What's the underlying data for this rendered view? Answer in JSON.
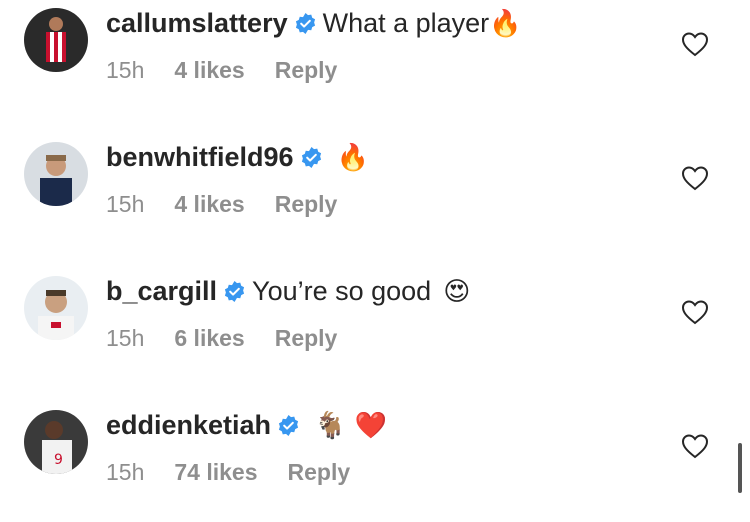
{
  "comments": [
    {
      "username": "callumslattery",
      "text": "What a player",
      "emoji": "🔥",
      "time": "15h",
      "likes": "4 likes",
      "reply": "Reply"
    },
    {
      "username": "benwhitfield96",
      "text": "",
      "emoji": "🔥",
      "time": "15h",
      "likes": "4 likes",
      "reply": "Reply"
    },
    {
      "username": "b_cargill",
      "text": "You’re so good",
      "emoji": "😍",
      "time": "15h",
      "likes": "6 likes",
      "reply": "Reply"
    },
    {
      "username": "eddienketiah",
      "text": "",
      "emoji": "🐐 ❤️",
      "time": "15h",
      "likes": "74 likes",
      "reply": "Reply"
    }
  ],
  "colors": {
    "verified": "#3897f0",
    "secondary_text": "#8e8e8e",
    "text": "#262626"
  },
  "icons": {
    "verified": "verified-badge-icon",
    "like": "heart-outline-icon"
  }
}
